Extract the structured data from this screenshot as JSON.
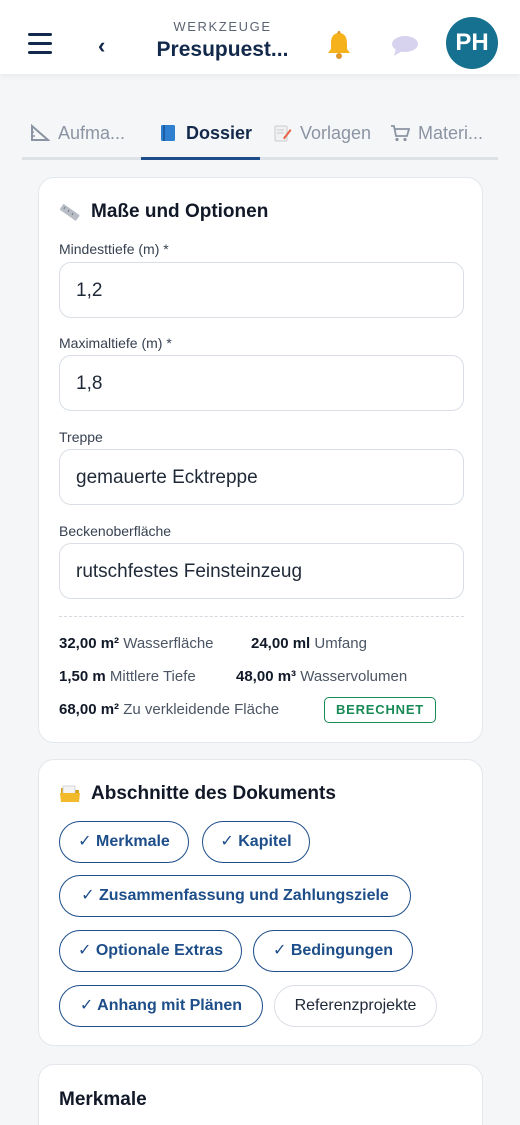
{
  "header": {
    "eyebrow": "WERKZEUGE",
    "title": "Presupuest...",
    "back_label": "‹",
    "avatar_initials": "PH",
    "avatar_color": "#16708f"
  },
  "tabs": [
    {
      "label": "Aufma...",
      "icon": "ruler-icon",
      "active": false
    },
    {
      "label": "Dossier",
      "icon": "book-icon",
      "active": true
    },
    {
      "label": "Vorlagen",
      "icon": "memo-icon",
      "active": false
    },
    {
      "label": "Materi...",
      "icon": "cart-icon",
      "active": false
    }
  ],
  "dimensions": {
    "title": "Maße und Optionen",
    "min_depth": {
      "label": "Mindesttiefe (m) *",
      "value": "1,2"
    },
    "max_depth": {
      "label": "Maximaltiefe (m) *",
      "value": "1,8"
    },
    "stairs": {
      "label": "Treppe",
      "value": "gemauerte Ecktreppe"
    },
    "surface": {
      "label": "Beckenoberfläche",
      "value": "rutschfestes Feinsteinzeug"
    },
    "stats": {
      "water_area": {
        "value": "32,00 m²",
        "label": "Wasserfläche"
      },
      "perimeter": {
        "value": "24,00 ml",
        "label": "Umfang"
      },
      "avg_depth": {
        "value": "1,50 m",
        "label": "Mittlere Tiefe"
      },
      "water_volume": {
        "value": "48,00 m³",
        "label": "Wasservolumen"
      },
      "cladding_area": {
        "value": "68,00 m²",
        "label": "Zu verkleidende Fläche"
      }
    },
    "badge": "BERECHNET",
    "badge_color": "#178a55"
  },
  "sections": {
    "title": "Abschnitte des Dokuments",
    "chips": [
      {
        "label": "✓ Merkmale",
        "selected": true
      },
      {
        "label": "✓ Kapitel",
        "selected": true
      },
      {
        "label": "✓ Zusammenfassung und Zahlungsziele",
        "selected": true
      },
      {
        "label": "✓ Optionale Extras",
        "selected": true
      },
      {
        "label": "✓ Bedingungen",
        "selected": true
      },
      {
        "label": "✓ Anhang mit Plänen",
        "selected": true
      },
      {
        "label": "Referenzprojekte",
        "selected": false
      }
    ]
  },
  "features": {
    "title": "Merkmale"
  },
  "colors": {
    "primary": "#1d4e89",
    "navy": "#13294b"
  }
}
